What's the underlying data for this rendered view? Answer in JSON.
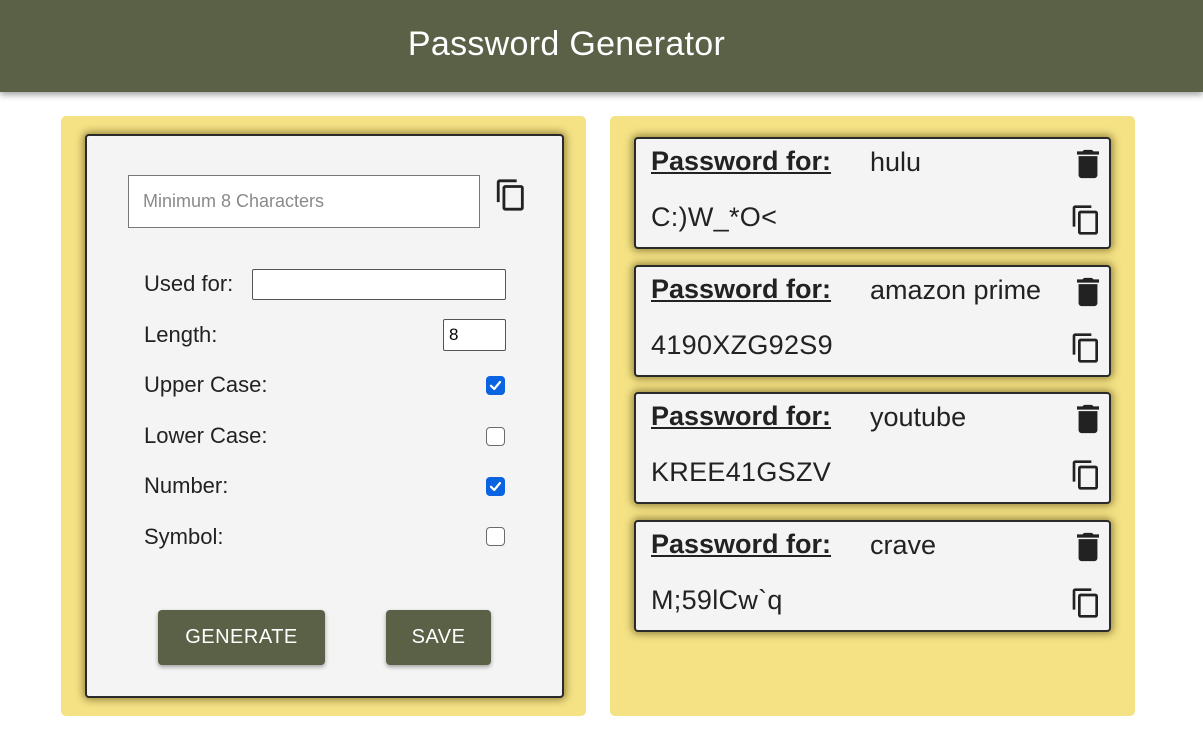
{
  "header": {
    "title": "Password Generator"
  },
  "generator": {
    "password_placeholder": "Minimum 8 Characters",
    "password_value": "",
    "copy_icon": "copy-icon",
    "used_for_label": "Used for:",
    "used_for_value": "",
    "length_label": "Length:",
    "length_value": "8",
    "uppercase_label": "Upper Case:",
    "uppercase_checked": true,
    "lowercase_label": "Lower Case:",
    "lowercase_checked": false,
    "number_label": "Number:",
    "number_checked": true,
    "symbol_label": "Symbol:",
    "symbol_checked": false,
    "generate_label": "GENERATE",
    "save_label": "SAVE"
  },
  "saved": [
    {
      "label": "Password for:",
      "site": "hulu",
      "password": "C:)W_*O<"
    },
    {
      "label": "Password for:",
      "site": "amazon prime",
      "password": "4190XZG92S9"
    },
    {
      "label": "Password for:",
      "site": "youtube",
      "password": "KREE41GSZV"
    },
    {
      "label": "Password for:",
      "site": "crave",
      "password": "M;59lCw`q"
    }
  ],
  "colors": {
    "header": "#5a6147",
    "panel": "#f5e285",
    "card": "#f4f4f4",
    "checkbox_on": "#0a63e0"
  }
}
